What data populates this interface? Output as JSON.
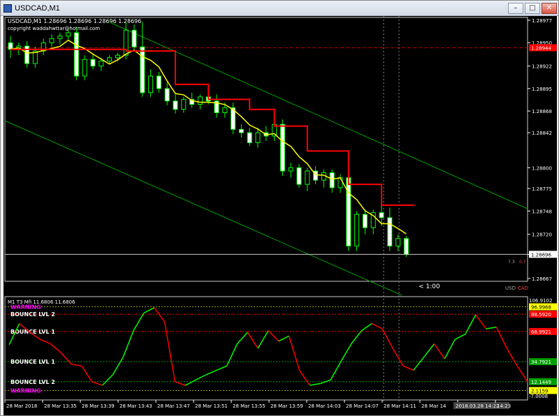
{
  "window": {
    "title": "USDCAD,M1",
    "minimize_glyph": "–",
    "maximize_glyph": "□",
    "close_glyph": "✕"
  },
  "main_panel": {
    "header": "USDCAD,M1  1.28696 1.28696 1.28696 1.28696",
    "copyright": "copyright waddahwttar@hotmail.com",
    "price_axis": [
      "1.28977",
      "1.28950",
      "1.28922",
      "1.28895",
      "1.28868",
      "1.28842",
      "1.28800",
      "1.28775",
      "1.28748",
      "1.28720",
      "1.28696",
      "1.28667"
    ],
    "red_line_price": "1.28944",
    "current_price": "1.28696",
    "timer": "< 1:00",
    "small_left": "7.3",
    "small_right": "0.7",
    "symbol_left": "USD",
    "symbol_right": "CAD",
    "colors": {
      "bull": "#ffffff",
      "bear": "#ffffff",
      "wick": "#00ff00",
      "ma": "#ffff00",
      "stop": "#ff0000",
      "channel": "#00a000"
    }
  },
  "indicator_panel": {
    "header": "M1  T3 Mfi  11.6806 11.6806",
    "axis_top": "106.9102",
    "axis_bottom": "-7.0008",
    "levels": [
      {
        "label": "WARNING",
        "value": "96.9968",
        "color": "#ff00ff",
        "bg": "#ffff00"
      },
      {
        "label": "BOUNCE LVL 2",
        "value": "88.5920",
        "color": "#ffffff",
        "bg": "#ff0000"
      },
      {
        "label": "BOUNCE LVL 1",
        "value": "68.9921",
        "color": "#ffffff",
        "bg": "#ff0000"
      },
      {
        "label": "BOUNCE LVL 1",
        "value": "34.7921",
        "color": "#ffffff",
        "bg": "#00a000"
      },
      {
        "label": "BOUNCE LVL 2",
        "value": "12.1449",
        "color": "#ffffff",
        "bg": "#00a000"
      },
      {
        "label": "WARNING",
        "value": "2.1159",
        "color": "#ff00ff",
        "bg": "#ffff00"
      }
    ]
  },
  "time_axis": [
    "28 Mar 2018",
    "28 Mar 13:35",
    "28 Mar 13:39",
    "28 Mar 13:43",
    "28 Mar 13:47",
    "28 Mar 13:51",
    "28 Mar 13:55",
    "28 Mar 13:59",
    "28 Mar 14:03",
    "28 Mar 14:07",
    "28 Mar 14:11",
    "28 Mar 14",
    "2018.03.28 14:22",
    "14:23"
  ],
  "chart_data": {
    "type": "candlestick",
    "title": "USDCAD,M1",
    "series": [
      {
        "name": "",
        "values": [
          [
            1.2895,
            1.28958,
            1.28932,
            1.28942
          ],
          [
            1.28942,
            1.2895,
            1.28935,
            1.28946
          ],
          [
            1.28946,
            1.28952,
            1.2892,
            1.28925
          ],
          [
            1.28925,
            1.28945,
            1.2892,
            1.2894
          ],
          [
            1.2894,
            1.28955,
            1.28935,
            1.2895
          ],
          [
            1.2895,
            1.2896,
            1.28945,
            1.28955
          ],
          [
            1.28955,
            1.28962,
            1.28948,
            1.28958
          ],
          [
            1.28958,
            1.28966,
            1.28954,
            1.28962
          ],
          [
            1.28962,
            1.28968,
            1.28905,
            1.2891
          ],
          [
            1.2891,
            1.28935,
            1.28905,
            1.2893
          ],
          [
            1.2893,
            1.28936,
            1.28918,
            1.28922
          ],
          [
            1.28922,
            1.28932,
            1.28916,
            1.28928
          ],
          [
            1.28928,
            1.28935,
            1.28924,
            1.28932
          ],
          [
            1.28932,
            1.28938,
            1.28928,
            1.28935
          ],
          [
            1.28935,
            1.28975,
            1.2893,
            1.28965
          ],
          [
            1.28965,
            1.28972,
            1.2894,
            1.28945
          ],
          [
            1.28945,
            1.28975,
            1.28885,
            1.2889
          ],
          [
            1.2889,
            1.28918,
            1.28885,
            1.2891
          ],
          [
            1.2891,
            1.28915,
            1.2889,
            1.28895
          ],
          [
            1.28895,
            1.28902,
            1.28875,
            1.2888
          ],
          [
            1.2888,
            1.28888,
            1.28865,
            1.2887
          ],
          [
            1.2887,
            1.28885,
            1.28866,
            1.28882
          ],
          [
            1.28882,
            1.2889,
            1.28872,
            1.28876
          ],
          [
            1.28876,
            1.28888,
            1.2887,
            1.28885
          ],
          [
            1.28885,
            1.2889,
            1.28876,
            1.2888
          ],
          [
            1.2888,
            1.28888,
            1.2886,
            1.28866
          ],
          [
            1.28866,
            1.28878,
            1.2886,
            1.28872
          ],
          [
            1.28872,
            1.28878,
            1.2884,
            1.28846
          ],
          [
            1.28846,
            1.28852,
            1.28836,
            1.28842
          ],
          [
            1.28842,
            1.28848,
            1.28826,
            1.2883
          ],
          [
            1.2883,
            1.28848,
            1.28824,
            1.28842
          ],
          [
            1.28842,
            1.2885,
            1.28832,
            1.28838
          ],
          [
            1.28838,
            1.28856,
            1.28832,
            1.28852
          ],
          [
            1.28852,
            1.28858,
            1.2879,
            1.28796
          ],
          [
            1.28796,
            1.28806,
            1.28788,
            1.288
          ],
          [
            1.288,
            1.28804,
            1.28776,
            1.2878
          ],
          [
            1.2878,
            1.288,
            1.28772,
            1.28796
          ],
          [
            1.28796,
            1.28802,
            1.2878,
            1.28785
          ],
          [
            1.28785,
            1.28798,
            1.28776,
            1.28794
          ],
          [
            1.28794,
            1.28798,
            1.2877,
            1.28776
          ],
          [
            1.28776,
            1.28792,
            1.2877,
            1.28788
          ],
          [
            1.28788,
            1.28792,
            1.287,
            1.28706
          ],
          [
            1.28706,
            1.28748,
            1.287,
            1.28744
          ],
          [
            1.28744,
            1.2875,
            1.2872,
            1.28728
          ],
          [
            1.28728,
            1.2875,
            1.2872,
            1.28746
          ],
          [
            1.28746,
            1.28756,
            1.2873,
            1.2874
          ],
          [
            1.2874,
            1.28752,
            1.287,
            1.28706
          ],
          [
            1.28706,
            1.2872,
            1.287,
            1.28715
          ],
          [
            1.28715,
            1.28718,
            1.28693,
            1.28696
          ]
        ]
      }
    ],
    "ylim": [
      1.28667,
      1.28977
    ],
    "indicator": {
      "name": "T3 Mfi",
      "ylim": [
        -7.0008,
        106.9102
      ],
      "values": [
        54,
        78,
        68,
        60,
        55,
        45,
        32,
        30,
        12,
        8,
        20,
        40,
        70,
        90,
        96,
        80,
        12,
        8,
        14,
        20,
        25,
        30,
        55,
        68,
        50,
        70,
        58,
        64,
        25,
        8,
        10,
        14,
        35,
        55,
        70,
        78,
        72,
        50,
        30,
        25,
        40,
        55,
        38,
        60,
        66,
        88,
        72,
        74,
        50,
        30,
        12
      ]
    }
  }
}
